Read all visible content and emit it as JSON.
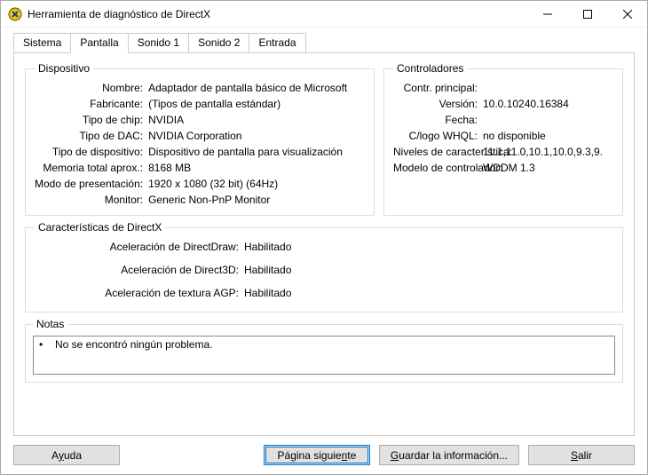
{
  "window": {
    "title": "Herramienta de diagnóstico de DirectX"
  },
  "tabs": {
    "sistema": "Sistema",
    "pantalla": "Pantalla",
    "sonido1": "Sonido 1",
    "sonido2": "Sonido 2",
    "entrada": "Entrada"
  },
  "device": {
    "legend": "Dispositivo",
    "labels": {
      "name": "Nombre:",
      "manufacturer": "Fabricante:",
      "chip": "Tipo de chip:",
      "dac": "Tipo de DAC:",
      "devtype": "Tipo de dispositivo:",
      "mem": "Memoria total aprox.:",
      "mode": "Modo de presentación:",
      "monitor": "Monitor:"
    },
    "values": {
      "name": "Adaptador de pantalla básico de Microsoft",
      "manufacturer": "(Tipos de pantalla estándar)",
      "chip": "NVIDIA",
      "dac": "NVIDIA Corporation",
      "devtype": "Dispositivo de pantalla para visualización",
      "mem": "8168 MB",
      "mode": "1920 x 1080 (32 bit) (64Hz)",
      "monitor": "Generic Non-PnP Monitor"
    }
  },
  "drivers": {
    "legend": "Controladores",
    "labels": {
      "main": "Contr. principal:",
      "version": "Versión:",
      "date": "Fecha:",
      "whql": "C/logo WHQL:",
      "feature": "Niveles de característica:",
      "model": "Modelo de controlador:"
    },
    "values": {
      "main": "",
      "version": "10.0.10240.16384",
      "date": "",
      "whql": "no disponible",
      "feature": "11.1,11.0,10.1,10.0,9.3,9.",
      "model": "WDDM 1.3"
    }
  },
  "dxfeatures": {
    "legend": "Características de DirectX",
    "labels": {
      "ddraw": "Aceleración de DirectDraw:",
      "d3d": "Aceleración de Direct3D:",
      "agp": "Aceleración de textura AGP:"
    },
    "values": {
      "ddraw": "Habilitado",
      "d3d": "Habilitado",
      "agp": "Habilitado"
    }
  },
  "notes": {
    "legend": "Notas",
    "text": "No se encontró ningún problema."
  },
  "buttons": {
    "help_pre": "A",
    "help_m": "y",
    "help_post": "uda",
    "next_pre": "Página siguie",
    "next_m": "n",
    "next_post": "te",
    "save_pre": "",
    "save_m": "G",
    "save_post": "uardar la información...",
    "exit_pre": "",
    "exit_m": "S",
    "exit_post": "alir"
  }
}
